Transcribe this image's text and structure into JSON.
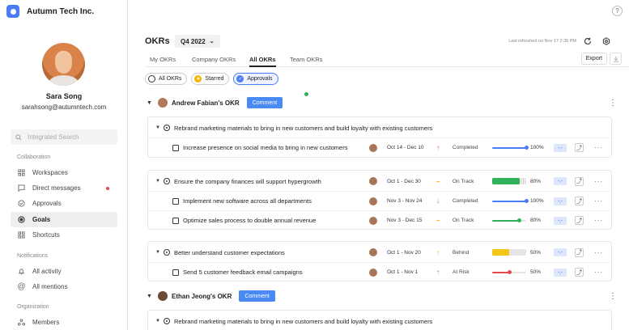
{
  "company": {
    "name": "Autumn Tech Inc."
  },
  "user": {
    "name": "Sara Song",
    "email": "sarahsong@autumntech.com"
  },
  "search": {
    "placeholder": "Integrated Search"
  },
  "sidebar": {
    "collaboration_label": "Collaboration",
    "collaboration": [
      {
        "label": "Workspaces",
        "icon": "grid-icon"
      },
      {
        "label": "Direct messages",
        "icon": "message-icon",
        "notification": true
      },
      {
        "label": "Approvals",
        "icon": "check-circle-icon"
      },
      {
        "label": "Goals",
        "icon": "target-icon",
        "active": true
      },
      {
        "label": "Shortcuts",
        "icon": "grid-icon"
      }
    ],
    "notifications_label": "Notifications",
    "notifications": [
      {
        "label": "All activity",
        "icon": "bell-icon"
      },
      {
        "label": "All mentions",
        "icon": "at-icon"
      }
    ],
    "organization_label": "Organization",
    "organization": [
      {
        "label": "Members",
        "icon": "members-icon"
      }
    ]
  },
  "header": {
    "title": "OKRs",
    "quarter": "Q4 2022",
    "refreshed": "Last refreshed on Nov 17 2:35 PM",
    "help": "?"
  },
  "tabs": [
    "My OKRs",
    "Company OKRs",
    "All OKRs",
    "Team OKRs"
  ],
  "export_label": "Export",
  "filters": [
    {
      "label": "All OKRs",
      "color": "#333333"
    },
    {
      "label": "Starred",
      "color": "#f5b400"
    },
    {
      "label": "Approvals",
      "color": "#4a7cf7",
      "selected": true
    }
  ],
  "comment_label": "Comment",
  "tag_label": "-,-",
  "groups": [
    {
      "owner": "Andrew Fabian's OKR",
      "objectives": [
        {
          "title": "Rebrand marketing materials to bring in new customers and build loyalty with existing customers",
          "key_results": [
            {
              "title": "Increase presence on social media to bring in new customers",
              "dates": "Oct 14 - Dec 10",
              "arrow": "↑",
              "arrow_color": "#e5484d",
              "status": "Completed",
              "progress": 100,
              "style": "slider",
              "color": "#4a7cf7"
            }
          ]
        },
        {
          "title": "Ensure the company finances will support hypergrowth",
          "dates": "Oct 1 - Dec 30",
          "arrow": "–",
          "arrow_color": "#f5b400",
          "status": "On Track",
          "progress": 80,
          "style": "bar",
          "color": "#2db15a",
          "key_results": [
            {
              "title": "Implement new software across all departments",
              "dates": "Nov 3 - Nov 24",
              "arrow": "↓",
              "arrow_color": "#2db15a",
              "status": "Completed",
              "progress": 100,
              "style": "slider",
              "color": "#4a7cf7"
            },
            {
              "title": "Optimize sales process to double annual revenue",
              "dates": "Nov 3 - Dec 15",
              "arrow": "–",
              "arrow_color": "#f5b400",
              "status": "On Track",
              "progress": 80,
              "style": "slider",
              "color": "#2db15a"
            }
          ]
        },
        {
          "title": "Better understand customer expectations",
          "dates": "Oct 1 - Nov 20",
          "arrow": "↑",
          "arrow_color": "#f5b400",
          "status": "Behind",
          "progress": 50,
          "style": "bar",
          "color": "#f5c518",
          "key_results": [
            {
              "title": "Send 5 customer feedback email campaigns",
              "dates": "Oct 1 - Nov 1",
              "arrow": "↑",
              "arrow_color": "#e5484d",
              "status": "At Risk",
              "progress": 50,
              "style": "slider",
              "color": "#e5484d"
            }
          ]
        }
      ]
    },
    {
      "owner": "Ethan Jeong's OKR",
      "objectives": [
        {
          "title": "Rebrand marketing materials to bring in new customers and build loyalty with existing customers"
        }
      ]
    }
  ]
}
